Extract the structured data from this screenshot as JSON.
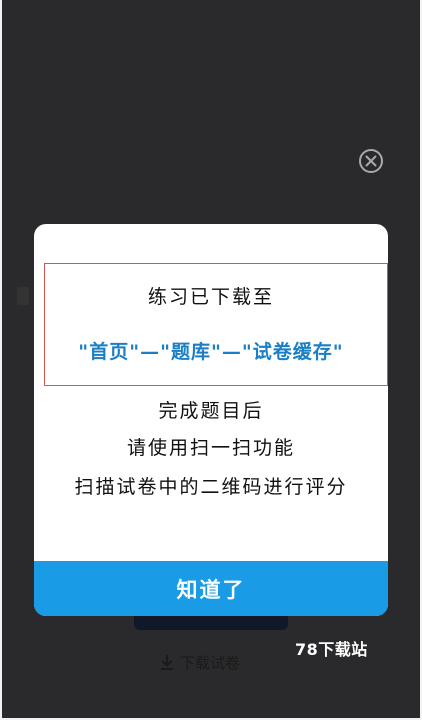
{
  "dialog": {
    "highlight_line1": "练习已下载至",
    "highlight_line2": "\"首页\"—\"题库\"—\"试卷缓存\"",
    "body_line1": "完成题目后",
    "body_line2": "请使用扫一扫功能",
    "body_line3": "扫描试卷中的二维码进行评分",
    "ok_label": "知道了"
  },
  "background": {
    "download_label": "下载试卷"
  },
  "watermark": {
    "text": "78下载站"
  },
  "icons": {
    "close": "close-circle-icon",
    "download": "download-icon"
  },
  "colors": {
    "accent": "#1a9be6",
    "highlight_text": "#1a7fc4",
    "highlight_border": "#d9534f",
    "overlay": "#2a2a2c"
  }
}
